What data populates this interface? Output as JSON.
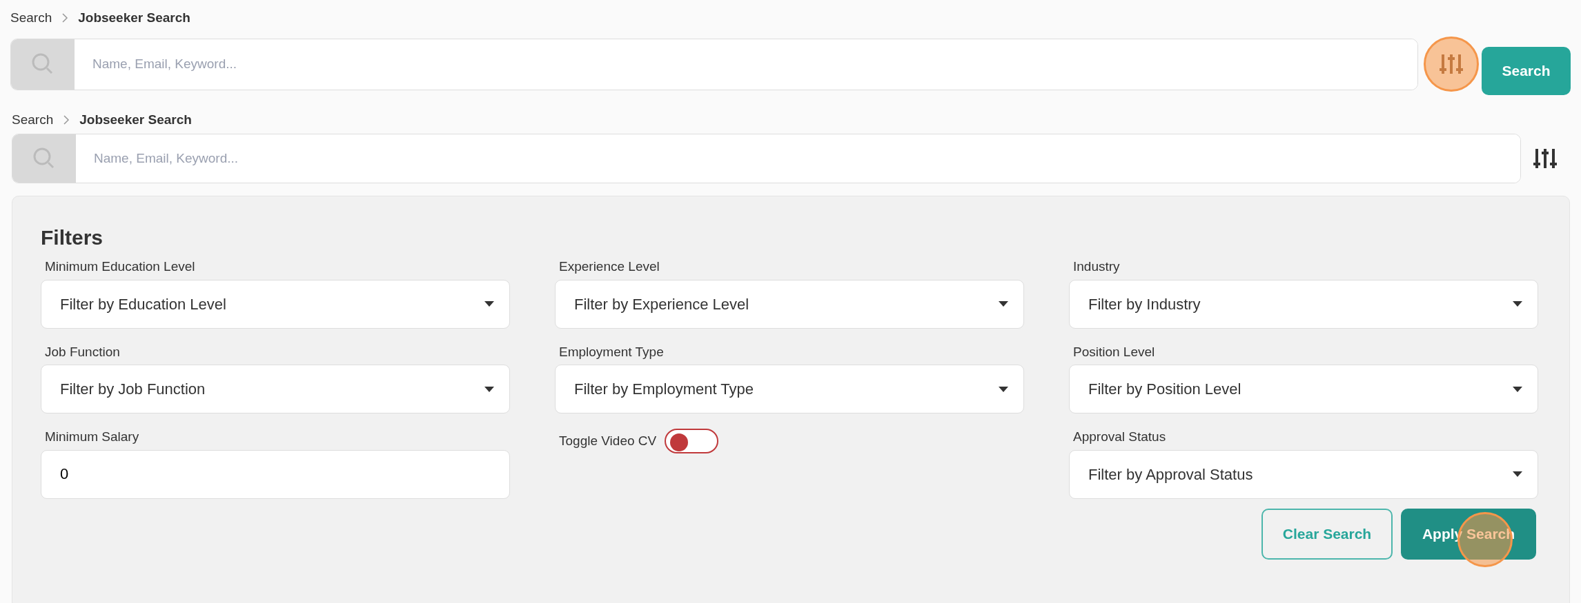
{
  "header": {
    "breadcrumb": [
      "Search",
      "Jobseeker Search"
    ],
    "search": {
      "placeholder": "Name, Email, Keyword..."
    },
    "filter_button": {
      "click_marker": true
    },
    "search_button": {
      "label": "Search"
    }
  },
  "second_header": {
    "breadcrumb": [
      "Search",
      "Jobseeker Search"
    ],
    "search": {
      "placeholder": "Name, Email, Keyword..."
    }
  },
  "filters": {
    "title": "Filters",
    "fields": [
      {
        "kind": "select",
        "label": "Minimum Education Level",
        "value": "Filter by Education Level"
      },
      {
        "kind": "select",
        "label": "Experience Level",
        "value": "Filter by Experience Level"
      },
      {
        "kind": "select",
        "label": "Industry",
        "value": "Filter by Industry"
      },
      {
        "kind": "select",
        "label": "Job Function",
        "value": "Filter by Job Function"
      },
      {
        "kind": "select",
        "label": "Employment Type",
        "value": "Filter by Employment Type"
      },
      {
        "kind": "select",
        "label": "Position Level",
        "value": "Filter by Position Level"
      },
      {
        "kind": "input",
        "label": "Minimum Salary",
        "value": "0"
      },
      {
        "kind": "toggle",
        "label": "Toggle Video CV",
        "on": false
      },
      {
        "kind": "select",
        "label": "Approval Status",
        "value": "Filter by Approval Status"
      }
    ],
    "buttons": [
      {
        "kind": "outline",
        "label": "Clear Search",
        "click_marker": false
      },
      {
        "kind": "solid",
        "label": "Apply Search",
        "click_marker": true
      }
    ]
  }
}
